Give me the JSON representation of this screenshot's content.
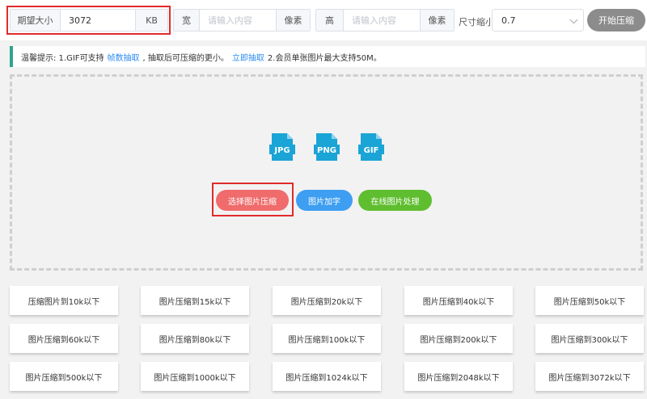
{
  "toolbar": {
    "expected_size": {
      "label": "期望大小",
      "value": "3072",
      "unit": "KB"
    },
    "width": {
      "label": "宽",
      "placeholder": "请输入内容",
      "unit": "像素"
    },
    "height": {
      "label": "高",
      "placeholder": "请输入内容",
      "unit": "像素"
    },
    "scale": {
      "label": "尺寸缩小",
      "value": "0.7"
    },
    "start_button": "开始压缩"
  },
  "tip": {
    "prefix": "温馨提示: 1.GIF可支持",
    "link1": "帧数抽取",
    "middle": ", 抽取后可压缩的更小。",
    "link2": "立即抽取",
    "suffix": "2.会员单张图片最大支持50M。"
  },
  "upload": {
    "file_types": [
      "JPG",
      "PNG",
      "GIF"
    ],
    "select_button": "选择图片压缩",
    "watermark_button": "图片加字",
    "online_button": "在线图片处理"
  },
  "quick_sizes": [
    "压缩图片到10k以下",
    "图片压缩到15k以下",
    "图片压缩到20k以下",
    "图片压缩到40k以下",
    "图片压缩到50k以下",
    "图片压缩到60k以下",
    "图片压缩到80k以下",
    "图片压缩到100k以下",
    "图片压缩到200k以下",
    "图片压缩到300k以下",
    "图片压缩到500k以下",
    "图片压缩到1000k以下",
    "图片压缩到1024k以下",
    "图片压缩到2048k以下",
    "图片压缩到3072k以下"
  ],
  "colors": {
    "accent": "#2fa58e",
    "link": "#2d8cf0",
    "file_icon": "#1ba4d6",
    "select_btn": "#f06b6b",
    "watermark_btn": "#3d9ef2",
    "online_btn": "#5fbe2f",
    "highlight": "#e02b2b"
  }
}
